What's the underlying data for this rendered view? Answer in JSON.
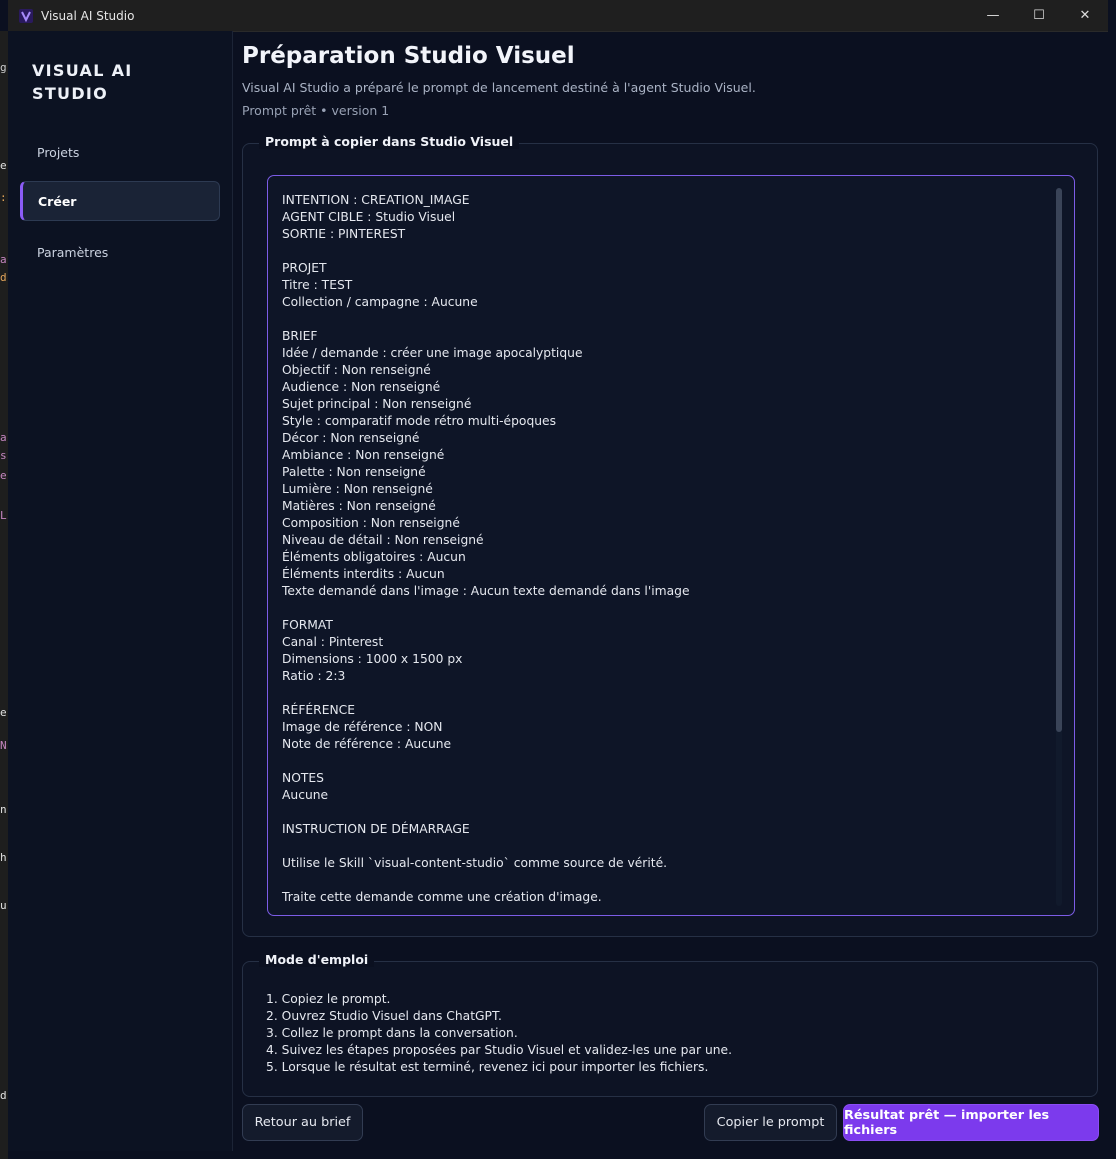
{
  "window": {
    "title": "Visual AI Studio"
  },
  "sidebar": {
    "brand": "VISUAL AI STUDIO",
    "items": [
      {
        "label": "Projets",
        "active": false
      },
      {
        "label": "Créer",
        "active": true
      },
      {
        "label": "Paramètres",
        "active": false
      }
    ]
  },
  "header": {
    "title": "Préparation Studio Visuel",
    "subtitle": "Visual AI Studio a préparé le prompt de lancement destiné à l'agent Studio Visuel.",
    "version": "Prompt prêt • version 1"
  },
  "prompt_section": {
    "label": "Prompt à copier dans Studio Visuel",
    "lines": [
      "INTENTION : CREATION_IMAGE",
      "AGENT CIBLE : Studio Visuel",
      "SORTIE : PINTEREST",
      "",
      "PROJET",
      "Titre : TEST",
      "Collection / campagne : Aucune",
      "",
      "BRIEF",
      "Idée / demande : créer une image apocalyptique",
      "Objectif : Non renseigné",
      "Audience : Non renseigné",
      "Sujet principal : Non renseigné",
      "Style : comparatif mode rétro multi-époques",
      "Décor : Non renseigné",
      "Ambiance : Non renseigné",
      "Palette : Non renseigné",
      "Lumière : Non renseigné",
      "Matières : Non renseigné",
      "Composition : Non renseigné",
      "Niveau de détail : Non renseigné",
      "Éléments obligatoires : Aucun",
      "Éléments interdits : Aucun",
      "Texte demandé dans l'image : Aucun texte demandé dans l'image",
      "",
      "FORMAT",
      "Canal : Pinterest",
      "Dimensions : 1000 x 1500 px",
      "Ratio : 2:3",
      "",
      "RÉFÉRENCE",
      "Image de référence : NON",
      "Note de référence : Aucune",
      "",
      "NOTES",
      "Aucune",
      "",
      "INSTRUCTION DE DÉMARRAGE",
      "",
      "Utilise le Skill `visual-content-studio` comme source de vérité.",
      "",
      "Traite cette demande comme une création d'image."
    ]
  },
  "instructions_section": {
    "label": "Mode d'emploi",
    "steps": [
      "1. Copiez le prompt.",
      "2. Ouvrez Studio Visuel dans ChatGPT.",
      "3. Collez le prompt dans la conversation.",
      "4. Suivez les étapes proposées par Studio Visuel et validez-les une par une.",
      "5. Lorsque le résultat est terminé, revenez ici pour importer les fichiers."
    ]
  },
  "buttons": {
    "back": "Retour au brief",
    "copy": "Copier le prompt",
    "import": "Résultat prêt — importer les fichiers"
  },
  "colors": {
    "accent": "#7c3aed",
    "background": "#0b1020",
    "sidebar": "#0c1222"
  }
}
